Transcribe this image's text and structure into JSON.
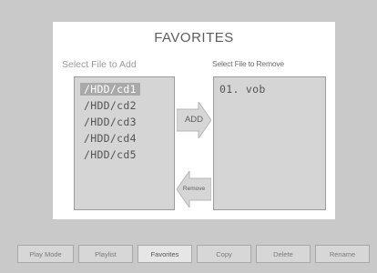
{
  "title": "FAVORITES",
  "add_section": {
    "label": "Select File to Add",
    "items": [
      "/HDD/cd1",
      "/HDD/cd2",
      "/HDD/cd3",
      "/HDD/cd4",
      "/HDD/cd5"
    ],
    "selected_index": 0
  },
  "remove_section": {
    "label": "Select File to Remove",
    "items": [
      "01. vob"
    ]
  },
  "actions": {
    "add_label": "ADD",
    "remove_label": "Remove",
    "add_icon": "arrow-right-icon",
    "remove_icon": "arrow-left-icon"
  },
  "bottom_bar": {
    "buttons": [
      "Play Mode",
      "Playlist",
      "Favorites",
      "Copy",
      "Delete",
      "Rename"
    ],
    "active_index": 2
  },
  "colors": {
    "background": "#c9c9c9",
    "panel": "#ffffff",
    "list_bg": "#d5d5d5",
    "selected": "#a9a9a9"
  }
}
